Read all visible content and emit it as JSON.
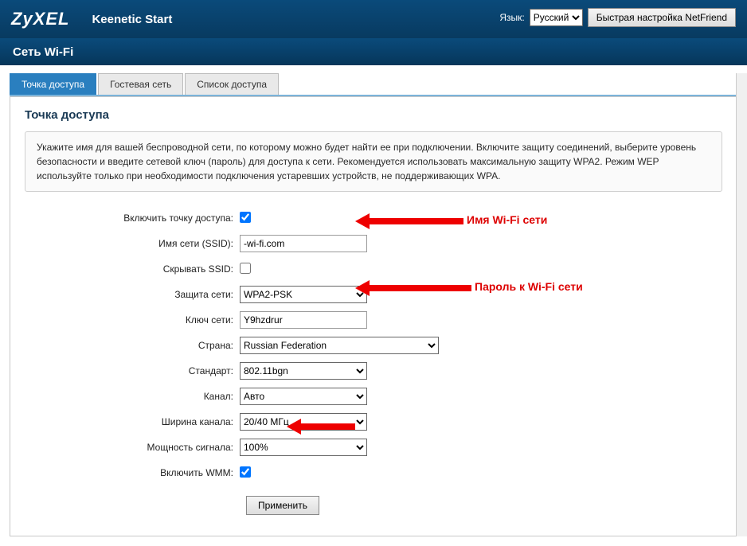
{
  "header": {
    "brand": "ZyXEL",
    "model": "Keenetic Start",
    "lang_label": "Язык:",
    "lang_value": "Русский",
    "quick_setup": "Быстрая настройка NetFriend"
  },
  "section_title": "Сеть Wi-Fi",
  "tabs": {
    "ap": "Точка доступа",
    "guest": "Гостевая сеть",
    "acl": "Список доступа"
  },
  "panel": {
    "heading": "Точка доступа",
    "info": "Укажите имя для вашей беспроводной сети, по которому можно будет найти ее при подключении. Включите защиту соединений, выберите уровень безопасности и введите сетевой ключ (пароль) для доступа к сети. Рекомендуется использовать максимальную защиту WPA2. Режим WEP используйте только при необходимости подключения устаревших устройств, не поддерживающих WPA."
  },
  "form": {
    "enable_ap_label": "Включить точку доступа:",
    "ssid_label": "Имя сети (SSID):",
    "ssid_value": "-wi-fi.com",
    "hide_ssid_label": "Скрывать SSID:",
    "security_label": "Защита сети:",
    "security_value": "WPA2-PSK",
    "key_label": "Ключ сети:",
    "key_value": "Y9hzdrur",
    "country_label": "Страна:",
    "country_value": "Russian Federation",
    "standard_label": "Стандарт:",
    "standard_value": "802.11bgn",
    "channel_label": "Канал:",
    "channel_value": "Авто",
    "width_label": "Ширина канала:",
    "width_value": "20/40 МГц",
    "power_label": "Мощность сигнала:",
    "power_value": "100%",
    "wmm_label": "Включить WMM:",
    "apply": "Применить"
  },
  "callouts": {
    "ssid": "Имя Wi-Fi сети",
    "key": "Пароль к Wi-Fi сети"
  }
}
